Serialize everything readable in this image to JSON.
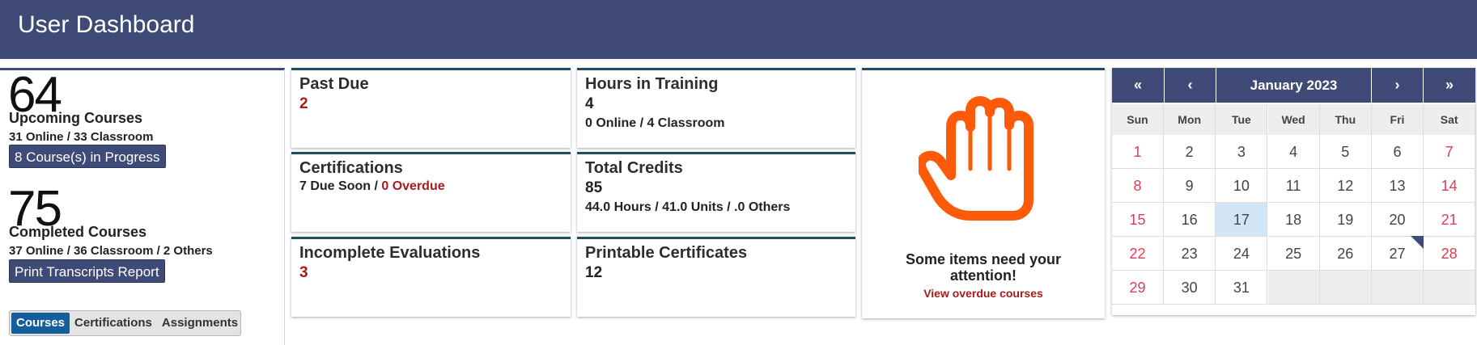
{
  "header": {
    "title": "User Dashboard"
  },
  "summary": {
    "upcoming": {
      "count": "64",
      "title": "Upcoming Courses",
      "breakdown": "31 Online / 33 Classroom",
      "in_progress_button": "8 Course(s) in Progress"
    },
    "completed": {
      "count": "75",
      "title": "Completed Courses",
      "breakdown": "37 Online / 36 Classroom / 2 Others",
      "transcript_button": "Print Transcripts Report"
    },
    "tabs": [
      "Courses",
      "Certifications",
      "Assignments"
    ]
  },
  "cards": {
    "past_due": {
      "title": "Past Due",
      "value": "2"
    },
    "certifications": {
      "title": "Certifications",
      "due_soon": "7 Due Soon /",
      "overdue": "0 Overdue"
    },
    "incomplete_evaluations": {
      "title": "Incomplete Evaluations",
      "value": "3"
    },
    "hours_in_training": {
      "title": "Hours in Training",
      "value": "4",
      "breakdown": "0 Online / 4 Classroom"
    },
    "total_credits": {
      "title": "Total Credits",
      "value": "85",
      "breakdown": "44.0 Hours / 41.0 Units / .0 Others"
    },
    "printable_certificates": {
      "title": "Printable Certificates",
      "value": "12"
    }
  },
  "attention": {
    "message_line1": "Some items need your",
    "message_line2": "attention!",
    "link": "View overdue courses"
  },
  "calendar": {
    "nav": {
      "prev_year": "«",
      "prev_month": "‹",
      "next_month": "›",
      "next_year": "»"
    },
    "month_label": "January  2023",
    "weekdays": [
      "Sun",
      "Mon",
      "Tue",
      "Wed",
      "Thu",
      "Fri",
      "Sat"
    ],
    "weeks": [
      [
        "1",
        "2",
        "3",
        "4",
        "5",
        "6",
        "7"
      ],
      [
        "8",
        "9",
        "10",
        "11",
        "12",
        "13",
        "14"
      ],
      [
        "15",
        "16",
        "17",
        "18",
        "19",
        "20",
        "21"
      ],
      [
        "22",
        "23",
        "24",
        "25",
        "26",
        "27",
        "28"
      ],
      [
        "29",
        "30",
        "31",
        "",
        "",
        "",
        ""
      ]
    ],
    "today": "17"
  },
  "colors": {
    "header": "#3f4a76",
    "accent_red": "#a61b1b",
    "weekend_red": "#e23b55",
    "hand_orange": "#ff5a0a",
    "active_tab": "#155e9c"
  },
  "icons": {
    "attention": "raised-hand-icon"
  }
}
